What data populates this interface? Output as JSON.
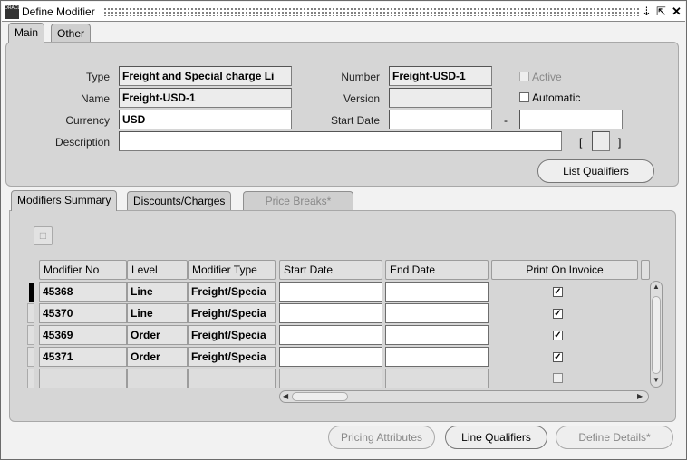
{
  "window": {
    "title": "Define Modifier",
    "icon_label": "ORACLE"
  },
  "top_tabs": [
    {
      "label": "Main"
    },
    {
      "label": "Other"
    }
  ],
  "form": {
    "type_label": "Type",
    "type_value": "Freight and Special charge Li",
    "name_label": "Name",
    "name_value": "Freight-USD-1",
    "currency_label": "Currency",
    "currency_value": "USD",
    "description_label": "Description",
    "description_value": "",
    "number_label": "Number",
    "number_value": "Freight-USD-1",
    "version_label": "Version",
    "version_value": "",
    "start_date_label": "Start Date",
    "start_date_value": "",
    "dash": "-",
    "end_date_value": "",
    "active_label": "Active",
    "active_checked": false,
    "automatic_label": "Automatic",
    "automatic_checked": false,
    "bracket_open": "[",
    "bracket_close": "]"
  },
  "buttons": {
    "list_qualifiers": "List Qualifiers",
    "pricing_attributes": "Pricing Attributes",
    "line_qualifiers": "Line Qualifiers",
    "define_details": "Define Details*"
  },
  "lower_tabs": [
    {
      "label": "Modifiers Summary"
    },
    {
      "label": "Discounts/Charges"
    },
    {
      "label": "Price Breaks*"
    }
  ],
  "grid": {
    "headers": [
      "Modifier No",
      "Level",
      "Modifier Type",
      "Start Date",
      "End Date",
      "Print On Invoice"
    ],
    "rows": [
      {
        "no": "45368",
        "level": "Line",
        "type": "Freight/Specia",
        "print": true
      },
      {
        "no": "45370",
        "level": "Line",
        "type": "Freight/Specia",
        "print": true
      },
      {
        "no": "45369",
        "level": "Order",
        "type": "Freight/Specia",
        "print": true
      },
      {
        "no": "45371",
        "level": "Order",
        "type": "Freight/Specia",
        "print": true
      },
      {
        "no": "",
        "level": "",
        "type": "",
        "print": false
      }
    ]
  },
  "colors": {
    "window_bg": "#f2f2f2",
    "panel_bg": "#d6d6d6",
    "field_bg": "#ffffff"
  }
}
